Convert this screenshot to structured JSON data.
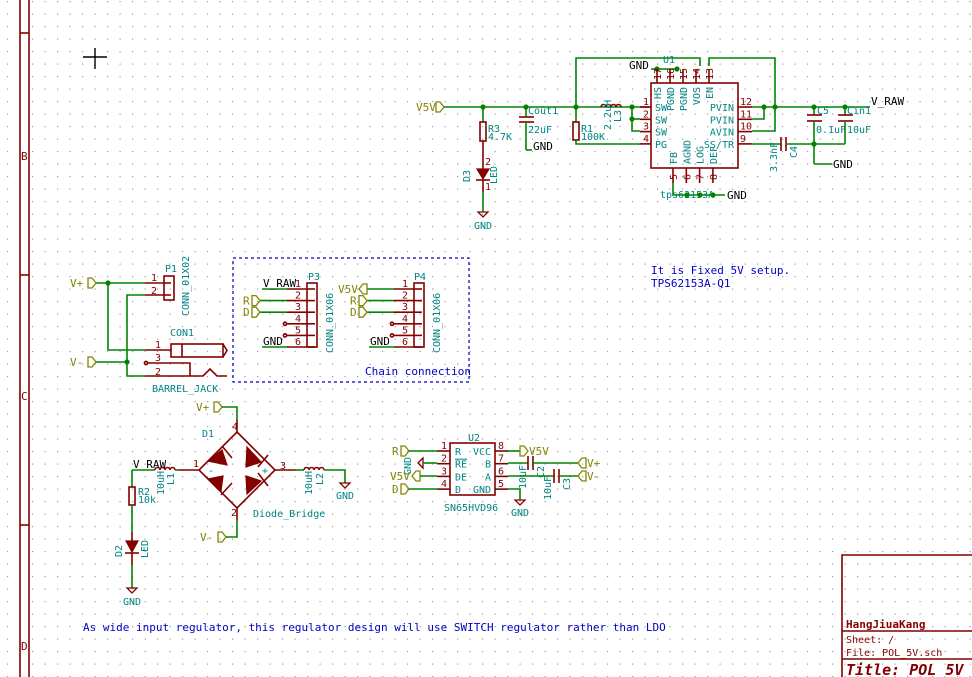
{
  "sheet": {
    "border_rows": [
      "B",
      "C",
      "D"
    ],
    "cursor": "crosshair-icon"
  },
  "regulator": {
    "input_label": "V5V",
    "output_label": "V_RAW",
    "u1": {
      "ref": "U1",
      "value": "tps62153A",
      "left_pins": [
        {
          "num": "1",
          "name": "SW"
        },
        {
          "num": "2",
          "name": "SW"
        },
        {
          "num": "3",
          "name": "SW"
        },
        {
          "num": "4",
          "name": "PG"
        }
      ],
      "right_pins": [
        {
          "num": "12",
          "name": "PVIN"
        },
        {
          "num": "11",
          "name": "PVIN"
        },
        {
          "num": "10",
          "name": "AVIN"
        },
        {
          "num": "9",
          "name": "SS/TR"
        }
      ],
      "top_pins": [
        {
          "num": "17",
          "name": "HS"
        },
        {
          "num": "16",
          "name": "PGND"
        },
        {
          "num": "15",
          "name": "PGND"
        },
        {
          "num": "14",
          "name": "VOS"
        },
        {
          "num": "13",
          "name": "EN"
        }
      ],
      "bottom_pins": [
        {
          "num": "5",
          "name": "FB"
        },
        {
          "num": "6",
          "name": "AGND"
        },
        {
          "num": "7",
          "name": "LOG"
        },
        {
          "num": "8",
          "name": "DEF"
        }
      ]
    },
    "r3": {
      "ref": "R3",
      "value": "4.7K"
    },
    "d3": {
      "ref": "D3",
      "value": "LED"
    },
    "cout1": {
      "ref": "Cout1",
      "value": "22uF"
    },
    "r1": {
      "ref": "R1",
      "value": "100K"
    },
    "l3": {
      "ref": "L3",
      "value": "2.2uH"
    },
    "c4": {
      "ref": "C4",
      "value": "3.3nF"
    },
    "c5": {
      "ref": "C5",
      "value": "0.1uF"
    },
    "cin1": {
      "ref": "Cin1",
      "value": "10uF"
    },
    "gnd": "GND"
  },
  "connectors": {
    "p1": {
      "ref": "P1",
      "value": "CONN_01X02",
      "pins": [
        "1",
        "2"
      ]
    },
    "con1": {
      "ref": "CON1",
      "value": "BARREL_JACK",
      "pins": [
        "1",
        "3",
        "2"
      ]
    },
    "vplus": "V+",
    "vminus": "V-",
    "chain_box_label": "Chain connection",
    "p3": {
      "ref": "P3",
      "value": "CONN_01X06",
      "pins": [
        "1",
        "2",
        "3",
        "4",
        "5",
        "6"
      ],
      "nets": [
        "V_RAW",
        "R",
        "D",
        "",
        "",
        "GND"
      ]
    },
    "p4": {
      "ref": "P4",
      "value": "CONN_01X06",
      "pins": [
        "1",
        "2",
        "3",
        "4",
        "5",
        "6"
      ],
      "nets": [
        "V5V",
        "R",
        "D",
        "",
        "",
        "GND"
      ]
    }
  },
  "bridge": {
    "d1": {
      "ref": "D1",
      "value": "Diode_Bridge",
      "pins": [
        "4",
        "1",
        "3",
        "2"
      ],
      "minus": "-",
      "plus": "+"
    },
    "l1": {
      "ref": "L1",
      "value": "10uH"
    },
    "l2": {
      "ref": "L2",
      "value": "10uH"
    },
    "r2": {
      "ref": "R2",
      "value": "10k"
    },
    "d2": {
      "ref": "D2",
      "value": "LED"
    },
    "vraw": "V_RAW",
    "vplus": "V+",
    "vminus": "V-",
    "gnd": "GND"
  },
  "transceiver": {
    "u2": {
      "ref": "U2",
      "value": "SN65HVD96",
      "left_pins": [
        {
          "num": "1",
          "name": "R"
        },
        {
          "num": "2",
          "name": "RE"
        },
        {
          "num": "3",
          "name": "DE"
        },
        {
          "num": "4",
          "name": "D"
        }
      ],
      "right_pins": [
        {
          "num": "8",
          "name": "VCC"
        },
        {
          "num": "7",
          "name": "B"
        },
        {
          "num": "6",
          "name": "A"
        },
        {
          "num": "5",
          "name": "GND"
        }
      ]
    },
    "c2": {
      "ref": "C2",
      "value": "10uF"
    },
    "c3": {
      "ref": "C3",
      "value": "10uF"
    },
    "labels": {
      "r": "R",
      "gnd": "GND",
      "v5v": "V5V",
      "d": "D",
      "vplus": "V+",
      "vminus": "V-",
      "v5v_out": "V5V"
    }
  },
  "notes": {
    "fixed_setup": "It is Fixed 5V setup.",
    "part": "TPS62153A-Q1",
    "wide_input": "As wide input regulator, this regulator design will use SWITCH regulator rather than LDO"
  },
  "title_block": {
    "company": "HangJiuaKang",
    "sheet": "Sheet: /",
    "file": "File: POL_5V.sch",
    "title": "Title: POL_5V"
  }
}
